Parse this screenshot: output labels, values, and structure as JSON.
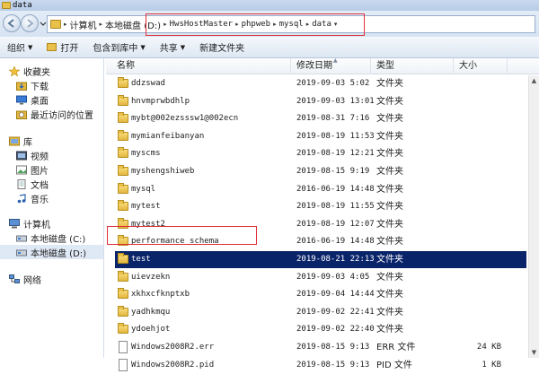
{
  "window": {
    "title": "data"
  },
  "address": {
    "crumbs": [
      {
        "label": "计算机",
        "mono": false
      },
      {
        "label": "本地磁盘 (D:)",
        "mono": false
      },
      {
        "label": "HwsHostMaster",
        "mono": true
      },
      {
        "label": "phpweb",
        "mono": true
      },
      {
        "label": "mysql",
        "mono": true
      },
      {
        "label": "data",
        "mono": true
      }
    ]
  },
  "toolbar": {
    "organize": "组织",
    "open": "打开",
    "include": "包含到库中",
    "share": "共享",
    "new_folder": "新建文件夹"
  },
  "nav": {
    "favorites": "收藏夹",
    "downloads": "下载",
    "desktop": "桌面",
    "recent": "最近访问的位置",
    "libraries": "库",
    "videos": "视频",
    "pictures": "图片",
    "documents": "文档",
    "music": "音乐",
    "computer": "计算机",
    "disk_c": "本地磁盘 (C:)",
    "disk_d": "本地磁盘 (D:)",
    "network": "网络"
  },
  "columns": {
    "name": "名称",
    "modified": "修改日期",
    "type": "类型",
    "size": "大小"
  },
  "files": [
    {
      "name": "ddzswad",
      "date": "2019-09-03 5:02",
      "type": "文件夹",
      "size": "",
      "kind": "folder"
    },
    {
      "name": "hnvmprwbdhlp",
      "date": "2019-09-03 13:01",
      "type": "文件夹",
      "size": "",
      "kind": "folder"
    },
    {
      "name": "mybt@002ezsssw1@002ecn",
      "date": "2019-08-31 7:16",
      "type": "文件夹",
      "size": "",
      "kind": "folder"
    },
    {
      "name": "mymianfeibanyan",
      "date": "2019-08-19 11:53",
      "type": "文件夹",
      "size": "",
      "kind": "folder"
    },
    {
      "name": "myscms",
      "date": "2019-08-19 12:21",
      "type": "文件夹",
      "size": "",
      "kind": "folder"
    },
    {
      "name": "myshengshiweb",
      "date": "2019-08-15 9:19",
      "type": "文件夹",
      "size": "",
      "kind": "folder"
    },
    {
      "name": "mysql",
      "date": "2016-06-19 14:48",
      "type": "文件夹",
      "size": "",
      "kind": "folder"
    },
    {
      "name": "mytest",
      "date": "2019-08-19 11:55",
      "type": "文件夹",
      "size": "",
      "kind": "folder"
    },
    {
      "name": "mytest2",
      "date": "2019-08-19 12:07",
      "type": "文件夹",
      "size": "",
      "kind": "folder"
    },
    {
      "name": "performance_schema",
      "date": "2016-06-19 14:48",
      "type": "文件夹",
      "size": "",
      "kind": "folder"
    },
    {
      "name": "test",
      "date": "2019-08-21 22:13",
      "type": "文件夹",
      "size": "",
      "kind": "folder",
      "selected": true
    },
    {
      "name": "uievzekn",
      "date": "2019-09-03 4:05",
      "type": "文件夹",
      "size": "",
      "kind": "folder"
    },
    {
      "name": "xkhxcfknptxb",
      "date": "2019-09-04 14:44",
      "type": "文件夹",
      "size": "",
      "kind": "folder"
    },
    {
      "name": "yadhkmqu",
      "date": "2019-09-02 22:41",
      "type": "文件夹",
      "size": "",
      "kind": "folder"
    },
    {
      "name": "ydoehjot",
      "date": "2019-09-02 22:40",
      "type": "文件夹",
      "size": "",
      "kind": "folder"
    },
    {
      "name": "Windows2008R2.err",
      "date": "2019-08-15 9:13",
      "type": "ERR 文件",
      "size": "24 KB",
      "kind": "file"
    },
    {
      "name": "Windows2008R2.pid",
      "date": "2019-08-15 9:13",
      "type": "PID 文件",
      "size": "1 KB",
      "kind": "file"
    }
  ],
  "colors": {
    "selection": "#0a246a",
    "highlight_box": "#e0303a",
    "folder": "#e8c04a"
  }
}
